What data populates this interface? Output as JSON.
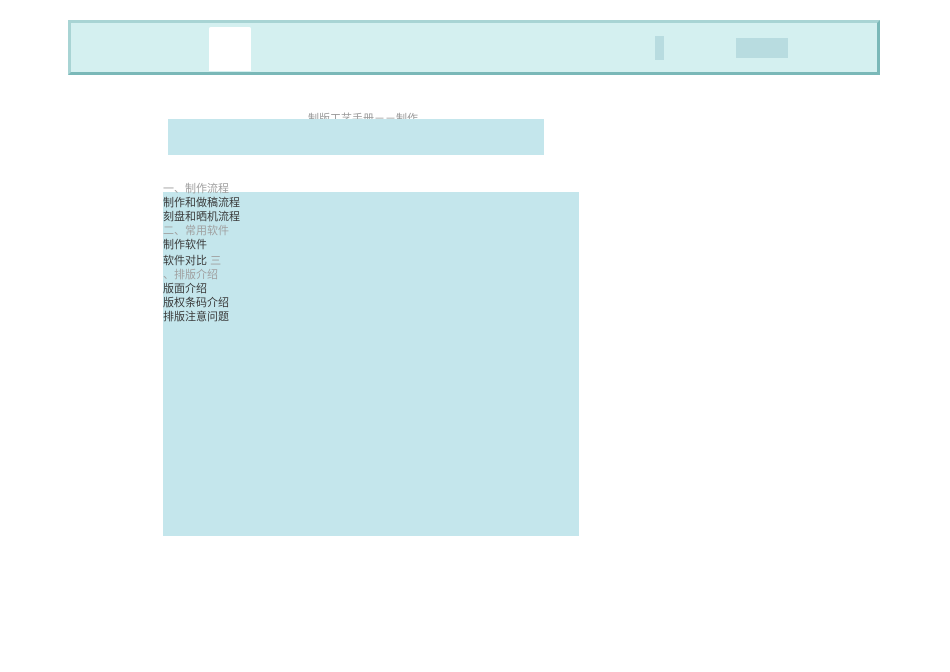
{
  "page_title": "制版工艺手册－－制作",
  "sections": {
    "s1": {
      "header": "一、制作流程",
      "items": [
        "制作和做稿流程",
        "刻盘和晒机流程"
      ]
    },
    "s2": {
      "header": "二、常用软件",
      "items": [
        "制作软件",
        "软件对比"
      ],
      "inline_header": "三"
    },
    "s3": {
      "header": "、排版介绍",
      "items": [
        "版面介绍",
        "版权条码介绍",
        "排版注意问题"
      ]
    }
  }
}
